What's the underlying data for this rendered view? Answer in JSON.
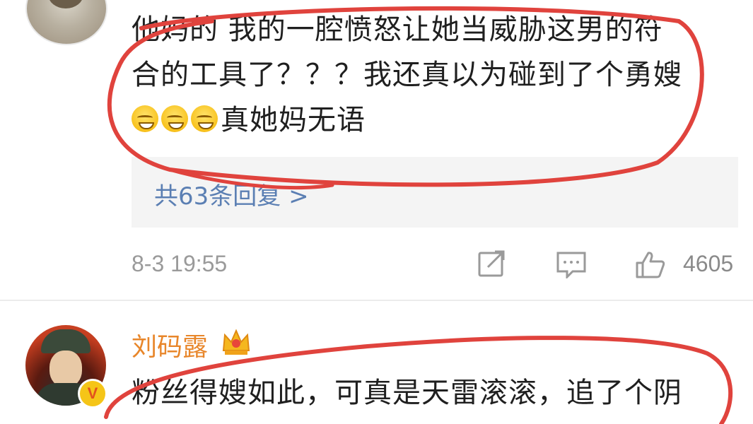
{
  "comment1": {
    "lines": [
      "他妈的 我的一腔愤怒让她当威胁这男的符",
      "合的工具了？？？我还真以为碰到了个勇嫂",
      "真她妈无语"
    ],
    "emoji_icon": "smirk-sweat-emoji",
    "emoji_count": 3,
    "reply_link": "共63条回复 >",
    "timestamp": "8-3 19:55",
    "like_count": "4605",
    "icons": [
      "share-icon",
      "comment-icon",
      "like-icon"
    ]
  },
  "comment2": {
    "username": "刘码露",
    "badge_icon": "crown-icon",
    "verified_badge": "V",
    "lines": [
      "粉丝得嫂如此，可真是天雷滚滚，追了个阴"
    ]
  },
  "colors": {
    "username": "#e8862a",
    "reply_link": "#5b7fb3",
    "annotation": "#e0433d",
    "meta_text": "#9a9a9a"
  }
}
